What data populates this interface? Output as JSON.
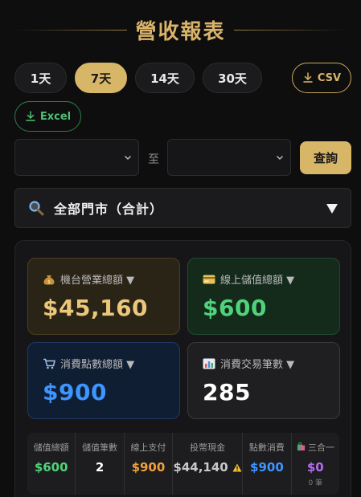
{
  "header": {
    "title": "營收報表"
  },
  "ranges": {
    "items": [
      {
        "label": "1天",
        "active": false
      },
      {
        "label": "7天",
        "active": true
      },
      {
        "label": "14天",
        "active": false
      },
      {
        "label": "30天",
        "active": false
      }
    ],
    "csv_label": "CSV",
    "excel_label": "Excel"
  },
  "date_range": {
    "start_value": "",
    "end_value": "",
    "to_label": "至",
    "query_label": "查詢"
  },
  "store_filter": {
    "label": "全部門市（合計）"
  },
  "cards": {
    "machine_revenue": {
      "label": "機台營業總額 ▼",
      "value": "$45,160",
      "icon": "money-bag-icon"
    },
    "online_topup": {
      "label": "線上儲值總額 ▼",
      "value": "$600",
      "icon": "credit-card-icon"
    },
    "points_consumed": {
      "label": "消費點數總額 ▼",
      "value": "$900",
      "icon": "cart-icon"
    },
    "transactions": {
      "label": "消費交易筆數 ▼",
      "value": "285",
      "icon": "bar-chart-icon"
    }
  },
  "stats": [
    {
      "label": "儲值總額",
      "value": "$600",
      "color": "#4fd37a"
    },
    {
      "label": "儲值筆數",
      "value": "2",
      "color": "#ffffff"
    },
    {
      "label": "線上支付",
      "value": "$900",
      "color": "#f0a13a"
    },
    {
      "label": "投幣現金",
      "value": "$44,140",
      "color": "#c8c8c8",
      "icon": "warning-icon"
    },
    {
      "label": "點數消費",
      "value": "$900",
      "color": "#3d95ff"
    },
    {
      "label": "三合一",
      "value": "$0",
      "sub": "0 筆",
      "color": "#b56cf0",
      "icon": "shopping-bag-icon"
    }
  ],
  "colors": {
    "accent_gold": "#d7b668",
    "bg": "#0e0e0f",
    "green": "#4fd37a",
    "blue": "#3d95ff"
  }
}
